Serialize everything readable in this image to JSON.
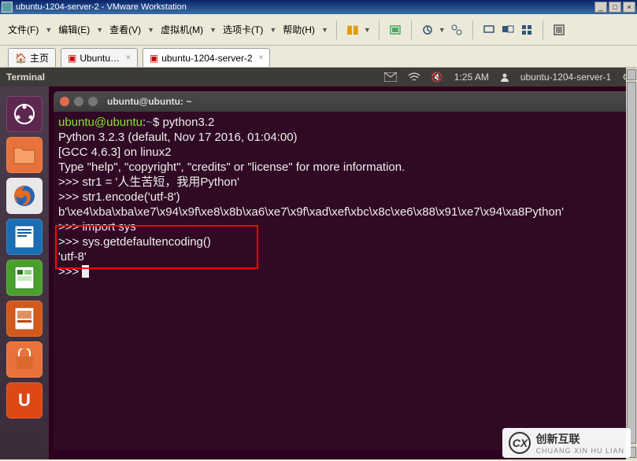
{
  "vmware": {
    "title": "ubuntu-1204-server-2 - VMware Workstation",
    "menus": [
      "文件(F)",
      "编辑(E)",
      "查看(V)",
      "虚拟机(M)",
      "选项卡(T)",
      "帮助(H)"
    ],
    "tabs": [
      {
        "label": "主页",
        "active": false
      },
      {
        "label": "Ubuntu…",
        "active": false
      },
      {
        "label": "ubuntu-1204-server-2",
        "active": true
      }
    ]
  },
  "ubuntu_top": {
    "app": "Terminal",
    "time": "1:25 AM",
    "user": "ubuntu-1204-server-1"
  },
  "term": {
    "title": "ubuntu@ubuntu: ~",
    "user": "ubuntu@ubuntu",
    "path": "~",
    "command1": "python3.2",
    "pyline1": "Python 3.2.3 (default, Nov 17 2016, 01:04:00)",
    "pyline2": "[GCC 4.6.3] on linux2",
    "pyline3": "Type \"help\", \"copyright\", \"credits\" or \"license\" for more information.",
    "stmt1": "str1 = '人生苦短，我用Python'",
    "stmt2": "str1.encode('utf-8')",
    "out2": "b'\\xe4\\xba\\xba\\xe7\\x94\\x9f\\xe8\\x8b\\xa6\\xe7\\x9f\\xad\\xef\\xbc\\x8c\\xe6\\x88\\x91\\xe7\\x94\\xa8Python'",
    "stmt3": "import sys",
    "stmt4": "sys.getdefaultencoding()",
    "out4": "'utf-8'",
    "prompt": ">>> "
  },
  "watermark": {
    "brand": "创新互联",
    "sub": "CHUANG XIN HU LIAN"
  }
}
